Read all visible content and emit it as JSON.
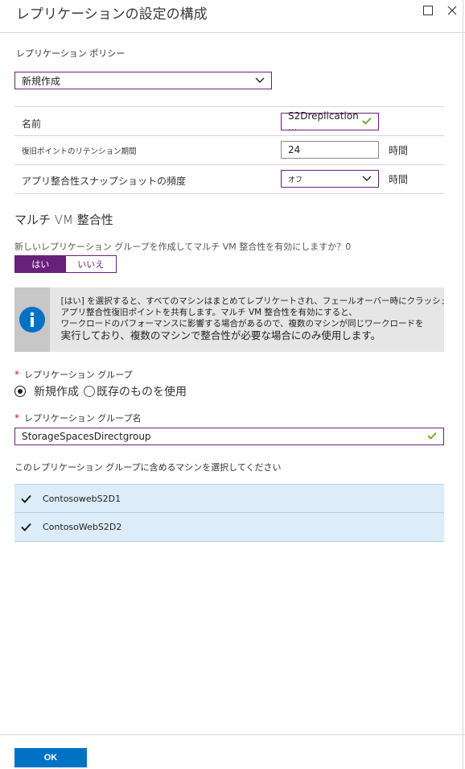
{
  "header": {
    "title": "レプリケーションの設定の構成"
  },
  "policy": {
    "label": "レプリケーション ポリシー",
    "value": "新規作成"
  },
  "settings": {
    "name_label": "名前",
    "name_value": "S2Dreplication ...",
    "retention_label": "復旧ポイントのリテンション期間",
    "retention_value": "24",
    "retention_unit": "時間",
    "snapshot_label": "アプリ整合性スナップショットの頻度",
    "snapshot_value": "オフ",
    "snapshot_unit": "時間"
  },
  "multivm": {
    "title": "マルチ VM 整合性",
    "question": "新しいレプリケーション グループを作成してマルチ VM 整合性を有効にしますか？0",
    "yes_label": "はい",
    "no_label": "いいえ",
    "info_line1": "[はい] を選択すると、すべてのマシンはまとめてレプリケートされ、フェールオーバー時にクラッシュ整合性復旧ポ",
    "info_line2": "アプリ整合性復旧ポイントを共有します。マルチ VM 整合性を有効にすると、",
    "info_line3": "ワークロードのパフォーマンスに影響する場合があるので、複数のマシンが同じワークロードを",
    "info_line4": "実行しており、複数のマシンで整合性が必要な場合にのみ使用します。"
  },
  "group": {
    "label": "レプリケーション グループ",
    "option_new": "新規作成",
    "option_existing": "既存のものを使用",
    "name_label": "レプリケーション グループ名",
    "name_value": "StorageSpacesDirectgroup"
  },
  "machines": {
    "label": "このレプリケーション グループに含めるマシンを選択してください",
    "items": [
      {
        "name": "ContosowebS2D1",
        "checked": true
      },
      {
        "name": "ContosoWebS2D2",
        "checked": true
      }
    ]
  },
  "footer": {
    "ok_label": "OK"
  },
  "colors": {
    "accent": "#68217a",
    "primary_button": "#0072c6",
    "valid_check": "#57a300",
    "row_selected": "#dcecf8"
  }
}
